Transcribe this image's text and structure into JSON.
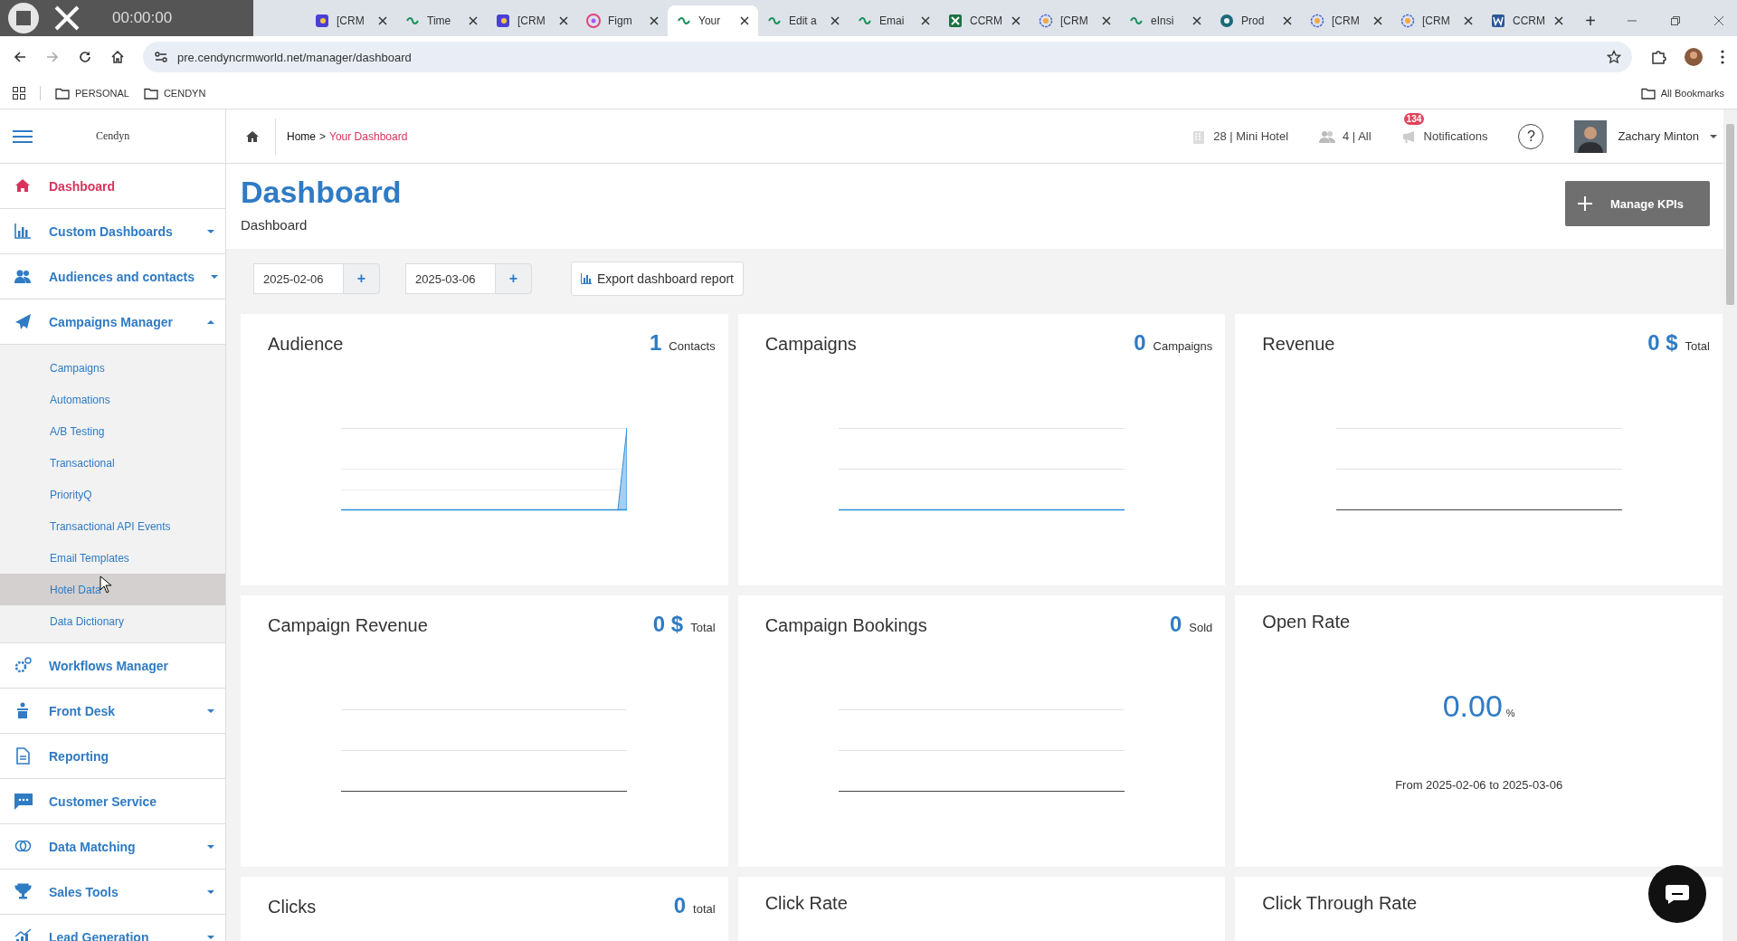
{
  "browser": {
    "recorder": {
      "timer": "00:00:00"
    },
    "tabs": [
      {
        "title": "[CRM",
        "selected": false
      },
      {
        "title": "Time",
        "selected": false
      },
      {
        "title": "[CRM",
        "selected": false
      },
      {
        "title": "Figm",
        "selected": false
      },
      {
        "title": "Your",
        "selected": true
      },
      {
        "title": "Edit a",
        "selected": false
      },
      {
        "title": "Emai",
        "selected": false
      },
      {
        "title": "CCRM",
        "selected": false
      },
      {
        "title": "[CRM",
        "selected": false
      },
      {
        "title": "eInsi",
        "selected": false
      },
      {
        "title": "Prod",
        "selected": false
      },
      {
        "title": "[CRM",
        "selected": false
      },
      {
        "title": "[CRM",
        "selected": false
      },
      {
        "title": "CCRM",
        "selected": false
      }
    ],
    "new_tab": "+",
    "address": "pre.cendyncrmworld.net/manager/dashboard",
    "bookmarks": [
      "PERSONAL",
      "CENDYN"
    ],
    "all_bookmarks": "All Bookmarks"
  },
  "app": {
    "logo": "Cendyn",
    "breadcrumb": {
      "home": "Home",
      "separator": ">",
      "current": "Your Dashboard"
    },
    "header": {
      "property": "28 | Mini Hotel",
      "users": "4 | All",
      "notifications": "Notifications",
      "notification_count": "134",
      "help": "?",
      "user": "Zachary Minton"
    },
    "sidebar": {
      "items": [
        {
          "label": "Dashboard",
          "selected": true,
          "dropdown": false
        },
        {
          "label": "Custom Dashboards",
          "selected": false,
          "dropdown": true,
          "expanded": false
        },
        {
          "label": "Audiences and contacts",
          "selected": false,
          "dropdown": true,
          "expanded": false
        },
        {
          "label": "Campaigns Manager",
          "selected": false,
          "dropdown": true,
          "expanded": true,
          "children": [
            {
              "label": "Campaigns",
              "hovered": false
            },
            {
              "label": "Automations",
              "hovered": false
            },
            {
              "label": "A/B Testing",
              "hovered": false
            },
            {
              "label": "Transactional",
              "hovered": false
            },
            {
              "label": "PriorityQ",
              "hovered": false
            },
            {
              "label": "Transactional API Events",
              "hovered": false
            },
            {
              "label": "Email Templates",
              "hovered": false
            },
            {
              "label": "Hotel Data",
              "hovered": true
            },
            {
              "label": "Data Dictionary",
              "hovered": false
            }
          ]
        },
        {
          "label": "Workflows Manager",
          "selected": false,
          "dropdown": false
        },
        {
          "label": "Front Desk",
          "selected": false,
          "dropdown": true,
          "expanded": false
        },
        {
          "label": "Reporting",
          "selected": false,
          "dropdown": false
        },
        {
          "label": "Customer Service",
          "selected": false,
          "dropdown": false
        },
        {
          "label": "Data Matching",
          "selected": false,
          "dropdown": true,
          "expanded": false
        },
        {
          "label": "Sales Tools",
          "selected": false,
          "dropdown": true,
          "expanded": false
        },
        {
          "label": "Lead Generation",
          "selected": false,
          "dropdown": true,
          "expanded": false
        }
      ]
    },
    "page": {
      "title": "Dashboard",
      "subtitle": "Dashboard",
      "manage_button": "Manage KPIs",
      "dates": [
        {
          "value": "2025-02-06",
          "button": "+"
        },
        {
          "value": "2025-03-06",
          "button": "+"
        }
      ],
      "export_button": "Export dashboard report"
    },
    "cards": [
      {
        "title": "Audience",
        "kind": "spike",
        "value": "1",
        "unit": "Contacts"
      },
      {
        "title": "Campaigns",
        "kind": "flat",
        "value": "0",
        "unit": "Campaigns"
      },
      {
        "title": "Revenue",
        "kind": "empty",
        "value": "0 $",
        "unit": "Total"
      },
      {
        "title": "Campaign Revenue",
        "kind": "empty",
        "value": "0 $",
        "unit": "Total"
      },
      {
        "title": "Campaign Bookings",
        "kind": "empty",
        "value": "0",
        "unit": "Sold"
      },
      {
        "title": "Open Rate",
        "kind": "rate",
        "value": "0.00",
        "unit": "%",
        "note": "From 2025-02-06 to 2025-03-06"
      },
      {
        "title": "Clicks",
        "kind": "blank",
        "value": "0",
        "unit": "total"
      },
      {
        "title": "Click Rate",
        "kind": "blank"
      },
      {
        "title": "Click Through Rate",
        "kind": "blank"
      }
    ]
  }
}
